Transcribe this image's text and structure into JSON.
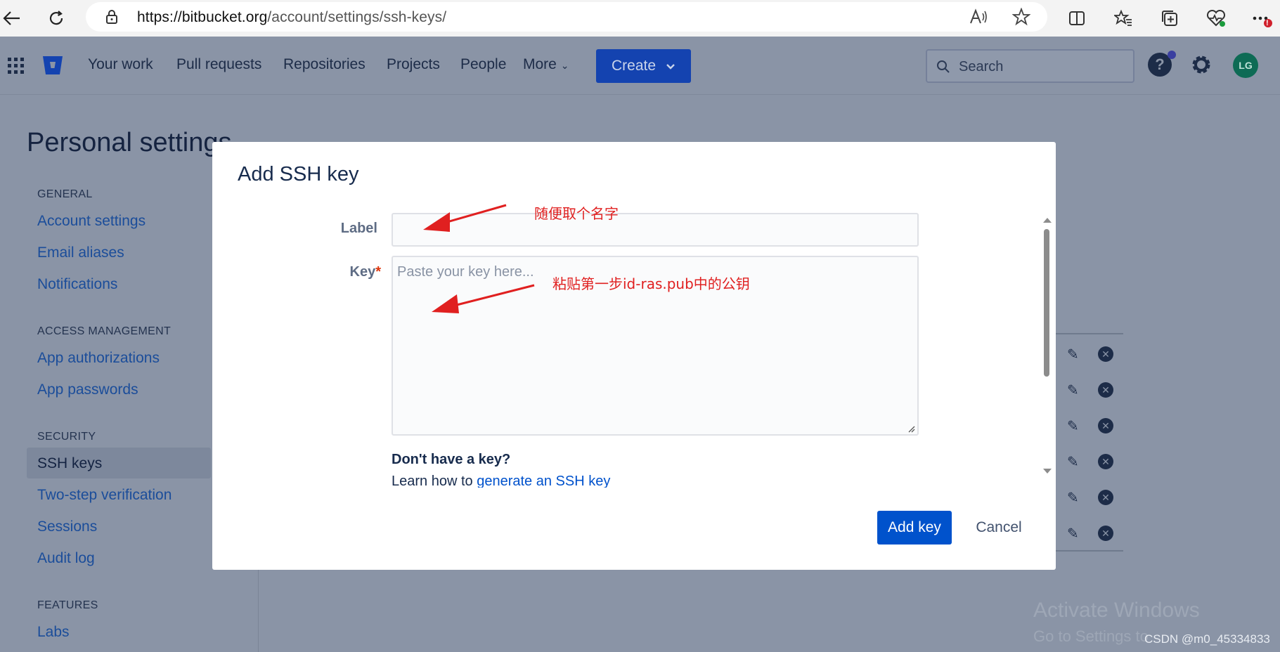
{
  "browser": {
    "url_host": "https://bitbucket.org",
    "url_path": "/account/settings/ssh-keys/",
    "icons": [
      "back-icon",
      "refresh-icon",
      "lock-icon",
      "read-aloud-icon",
      "favorite-star-icon",
      "split-screen-icon",
      "favorites-icon",
      "collections-icon",
      "health-icon",
      "more-icon"
    ],
    "notification_badge": "!"
  },
  "nav": {
    "items": [
      "Your work",
      "Pull requests",
      "Repositories",
      "Projects",
      "People",
      "More"
    ],
    "create_label": "Create",
    "search_placeholder": "Search",
    "avatar_initials": "LG",
    "help_icon": "?",
    "accent": "#0052cc"
  },
  "sidebar": {
    "page_title": "Personal settings",
    "sections": [
      {
        "heading": "GENERAL",
        "links": [
          "Account settings",
          "Email aliases",
          "Notifications"
        ]
      },
      {
        "heading": "ACCESS MANAGEMENT",
        "links": [
          "App authorizations",
          "App passwords"
        ]
      },
      {
        "heading": "SECURITY",
        "links": [
          "SSH keys",
          "Two-step verification",
          "Sessions",
          "Audit log"
        ]
      },
      {
        "heading": "FEATURES",
        "links": [
          "Labs"
        ]
      }
    ],
    "active": "SSH keys"
  },
  "modal": {
    "title": "Add SSH key",
    "label_field": {
      "label": "Label",
      "value": ""
    },
    "key_field": {
      "label": "Key",
      "required_mark": "*",
      "placeholder": "Paste your key here..."
    },
    "help_title": "Don't have a key?",
    "help_text": "Learn how to ",
    "help_link": "generate an SSH key",
    "add_button": "Add key",
    "cancel_button": "Cancel"
  },
  "annotations": {
    "label_note": "随便取个名字",
    "key_note": "粘贴第一步id-ras.pub中的公钥"
  },
  "overlay_text": {
    "activate_title": "Activate Windows",
    "activate_sub": "Go to Settings to",
    "watermark": "CSDN @m0_45334833"
  }
}
